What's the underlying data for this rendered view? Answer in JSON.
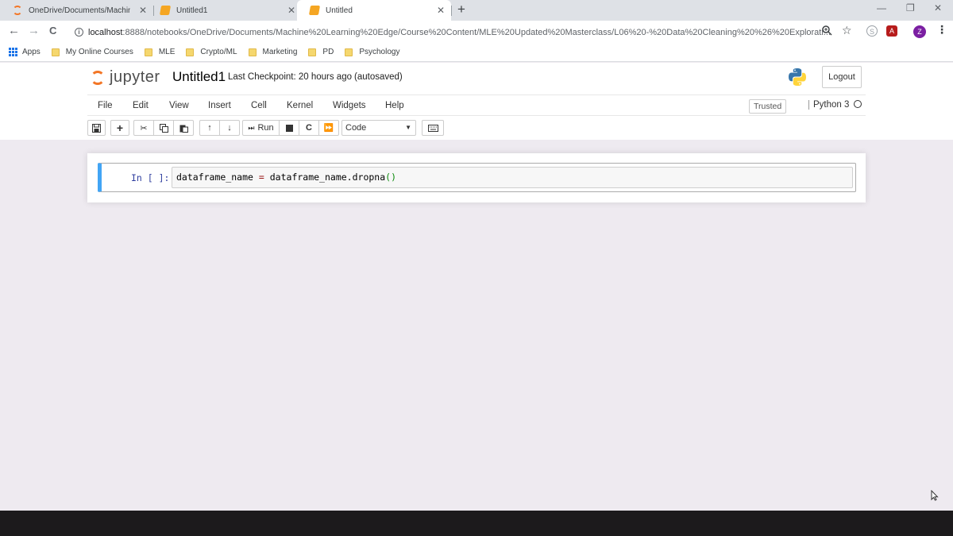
{
  "browser": {
    "tabs": [
      {
        "title": "OneDrive/Documents/Machine L",
        "icon": "jupyter-icon",
        "active": false
      },
      {
        "title": "Untitled1",
        "icon": "notebook-icon",
        "active": false
      },
      {
        "title": "Untitled",
        "icon": "notebook-icon",
        "active": true
      }
    ],
    "close_glyph": "✕",
    "new_tab_glyph": "+",
    "window_controls": {
      "minimize": "—",
      "restore": "❐",
      "close": "✕"
    },
    "nav": {
      "back": "←",
      "forward": "→",
      "reload": "C"
    },
    "url_host": "localhost",
    "url_path": ":8888/notebooks/OneDrive/Documents/Machine%20Learning%20Edge/Course%20Content/MLE%20Updated%20Masterclass/L06%20-%20Data%20Cleaning%20%26%20Explorati...",
    "profile_initial": "Z",
    "bookmarks": {
      "apps_label": "Apps",
      "items": [
        "My Online Courses",
        "MLE",
        "Crypto/ML",
        "Marketing",
        "PD",
        "Psychology"
      ]
    }
  },
  "jupyter": {
    "logo_text": "jupyter",
    "notebook_name": "Untitled1",
    "checkpoint": "Last Checkpoint: 20 hours ago",
    "autosave": "(autosaved)",
    "logout_label": "Logout",
    "menu": [
      "File",
      "Edit",
      "View",
      "Insert",
      "Cell",
      "Kernel",
      "Widgets",
      "Help"
    ],
    "trusted_label": "Trusted",
    "kernel_name": "Python 3",
    "toolbar": {
      "run_label": "Run",
      "cell_type": "Code"
    },
    "cell": {
      "prompt": "In [ ]:",
      "code_lhs": "dataframe_name",
      "code_op": "=",
      "code_rhs": "dataframe_name.dropna",
      "code_parens": "()"
    }
  },
  "colors": {
    "accent_orange": "#f37626",
    "cell_selected_bar": "#42a5f5",
    "page_background": "#eeeaf0",
    "taskbar": "#1c1a1c"
  }
}
